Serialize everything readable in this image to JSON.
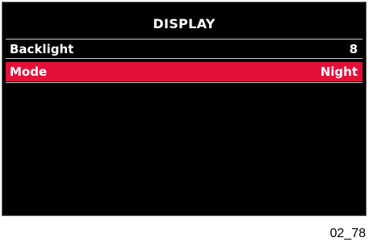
{
  "screen": {
    "title": "DISPLAY",
    "items": [
      {
        "label": "Backlight",
        "value": "8",
        "selected": false
      },
      {
        "label": "Mode",
        "value": "Night",
        "selected": true
      }
    ]
  },
  "figure_id": "02_78",
  "colors": {
    "background": "#000000",
    "text": "#ffffff",
    "selection": "#e4103a",
    "separator": "#c8c8c8"
  }
}
